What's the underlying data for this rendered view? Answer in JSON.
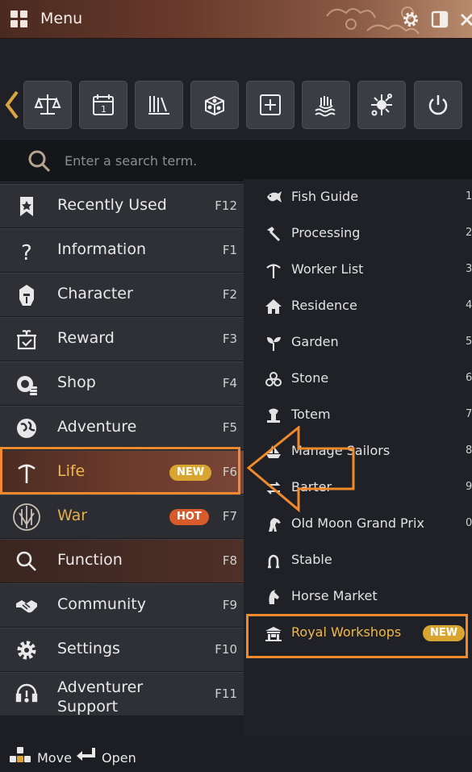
{
  "titlebar": {
    "title": "Menu"
  },
  "search": {
    "placeholder": "Enter a search term."
  },
  "toolbar": {
    "icons": [
      "scales-icon",
      "calendar-icon",
      "books-icon",
      "dice-icon",
      "plus-box-icon",
      "wave-hand-icon",
      "sparkle-icon",
      "power-icon"
    ]
  },
  "menu": [
    {
      "label": "Recently Used",
      "key": "F12"
    },
    {
      "label": "Information",
      "key": "F1"
    },
    {
      "label": "Character",
      "key": "F2"
    },
    {
      "label": "Reward",
      "key": "F3"
    },
    {
      "label": "Shop",
      "key": "F4"
    },
    {
      "label": "Adventure",
      "key": "F5"
    },
    {
      "label": "Life",
      "key": "F6",
      "badge": "NEW"
    },
    {
      "label": "War",
      "key": "F7",
      "badge": "HOT"
    },
    {
      "label": "Function",
      "key": "F8"
    },
    {
      "label": "Community",
      "key": "F9"
    },
    {
      "label": "Settings",
      "key": "F10"
    },
    {
      "label_line1": "Adventurer",
      "label_line2": "Support",
      "key": "F11"
    }
  ],
  "life_submenu": [
    {
      "label": "Fish Guide",
      "num": "1"
    },
    {
      "label": "Processing",
      "num": "2"
    },
    {
      "label": "Worker List",
      "num": "3"
    },
    {
      "label": "Residence",
      "num": "4"
    },
    {
      "label": "Garden",
      "num": "5"
    },
    {
      "label": "Stone",
      "num": "6"
    },
    {
      "label": "Totem",
      "num": "7"
    },
    {
      "label": "Manage Sailors",
      "num": "8"
    },
    {
      "label": "Barter",
      "num": "9"
    },
    {
      "label": "Old Moon Grand Prix",
      "num": "0"
    },
    {
      "label": "Stable",
      "num": ""
    },
    {
      "label": "Horse Market",
      "num": ""
    },
    {
      "label": "Royal Workshops",
      "num": "",
      "badge": "NEW"
    }
  ],
  "footer": {
    "move": "Move",
    "open": "Open"
  },
  "colors": {
    "accent": "#f0b84a",
    "highlight": "#f08a2c",
    "new_badge": "#d8a531",
    "hot_badge": "#d95a2a"
  }
}
